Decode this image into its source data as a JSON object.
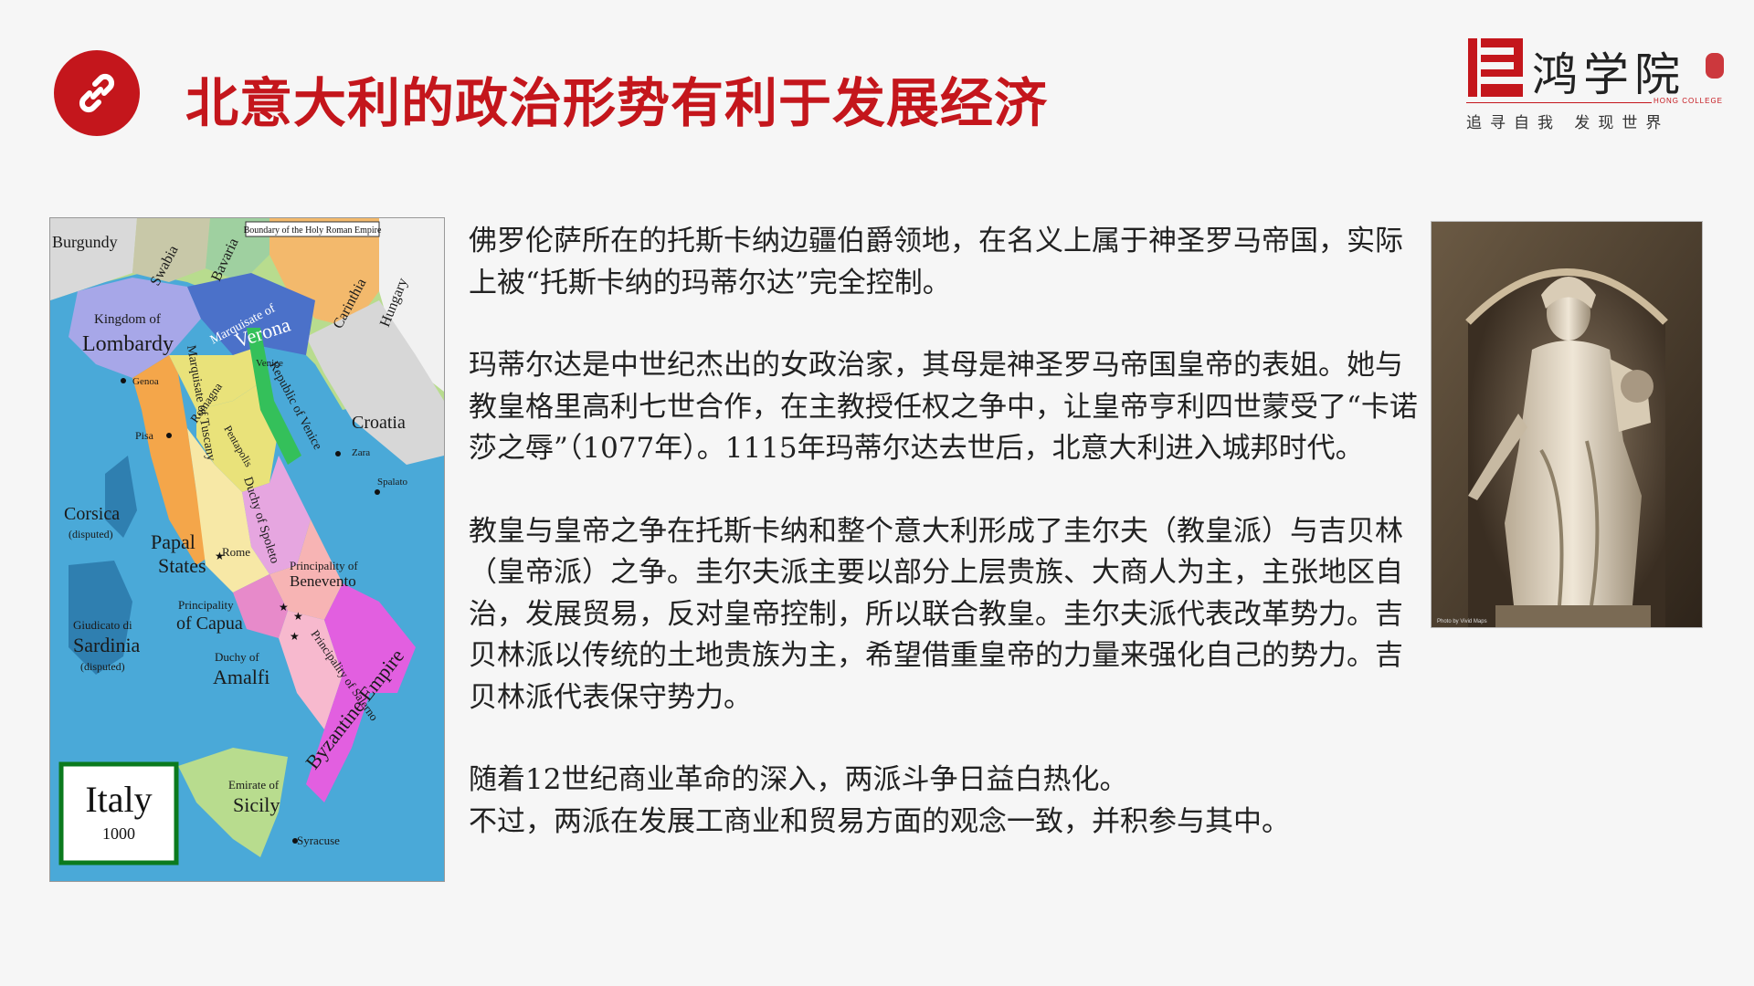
{
  "header": {
    "title": "北意大利的政治形势有利于发展经济",
    "link_icon": "link-icon"
  },
  "logo": {
    "name": "鸿学院",
    "english": "HONG COLLEGE",
    "tagline": "追寻自我 发现世界"
  },
  "map": {
    "legend_box": "Boundary of the Holy Roman Empire",
    "title": "Italy",
    "year": "1000",
    "labels": {
      "burgundy": "Burgundy",
      "swabia": "Swabia",
      "bavaria": "Bavaria",
      "carinthia": "Carinthia",
      "hungary": "Hungary",
      "kingdom_of": "Kingdom of",
      "lombardy": "Lombardy",
      "marquisate_of": "Marquisate of",
      "verona": "Verona",
      "venice": "Venice",
      "genoa": "Genoa",
      "pisa": "Pisa",
      "marquisate_of_tuscany": "Marquisate of Tuscany",
      "romagna": "Romagna",
      "pentapolis": "Pentapolis",
      "republic_of_venice": "Republic of Venice",
      "croatia": "Croatia",
      "zara": "Zara",
      "spalato": "Spalato",
      "corsica": "Corsica",
      "disputed": "(disputed)",
      "papal": "Papal",
      "states": "States",
      "rome": "Rome",
      "duchy_of_spoleto": "Duchy of Spoleto",
      "principality_of": "Principality of",
      "benevento": "Benevento",
      "principality": "Principality",
      "of_capua": "of Capua",
      "giudicato_di": "Giudicato di",
      "sardinia": "Sardinia",
      "duchy_of": "Duchy of",
      "amalfi": "Amalfi",
      "principality_of_salerno": "Principality of Salerno",
      "byzantine_empire": "Byzantine Empire",
      "emirate_of": "Emirate of",
      "sicily": "Sicily",
      "syracuse": "Syracuse"
    }
  },
  "content": {
    "p1": "佛罗伦萨所在的托斯卡纳边疆伯爵领地，在名义上属于神圣罗马帝国，实际上被“托斯卡纳的玛蒂尔达”完全控制。",
    "p2": "玛蒂尔达是中世纪杰出的女政治家，其母是神圣罗马帝国皇帝的表姐。她与教皇格里高利七世合作，在主教授任权之争中，让皇帝亨利四世蒙受了“卡诺莎之辱”（1077年）。1115年玛蒂尔达去世后，北意大利进入城邦时代。",
    "p3": "教皇与皇帝之争在托斯卡纳和整个意大利形成了圭尔夫（教皇派）与吉贝林（皇帝派）之争。圭尔夫派主要以部分上层贵族、大商人为主，主张地区自治，发展贸易，反对皇帝控制，所以联合教皇。圭尔夫派代表改革势力。吉贝林派以传统的土地贵族为主，希望借重皇帝的力量来强化自己的势力。吉贝林派代表保守势力。",
    "p4": "随着12世纪商业革命的深入，两派斗争日益白热化。",
    "p5": "不过，两派在发展工商业和贸易方面的观念一致，并积参与其中。"
  },
  "statue": {
    "credit": "Photo by Vivid Maps"
  },
  "colors": {
    "accent": "#c4161c",
    "sea": "#4aa9d8"
  }
}
